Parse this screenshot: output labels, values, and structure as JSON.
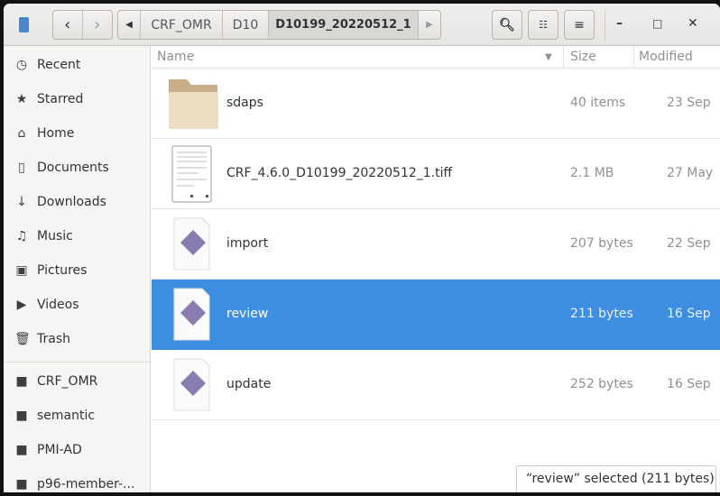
{
  "window": {
    "title": "D10199_20220512_1"
  },
  "toolbar": {
    "back": "back",
    "forward": "forward",
    "search": "search",
    "view_grid": "grid-view",
    "menu": "menu",
    "minimize": "minimize",
    "maximize": "maximize",
    "close": "close"
  },
  "breadcrumb": [
    "CRF_OMR",
    "D10",
    "D10199_20220512_1"
  ],
  "sidebar": {
    "places": [
      {
        "label": "Recent",
        "icon": "clock-icon"
      },
      {
        "label": "Starred",
        "icon": "star-icon"
      },
      {
        "label": "Home",
        "icon": "home-icon"
      },
      {
        "label": "Documents",
        "icon": "document-icon"
      },
      {
        "label": "Downloads",
        "icon": "download-icon"
      },
      {
        "label": "Music",
        "icon": "music-icon"
      },
      {
        "label": "Pictures",
        "icon": "camera-icon"
      },
      {
        "label": "Videos",
        "icon": "video-icon"
      },
      {
        "label": "Trash",
        "icon": "trash-icon"
      }
    ],
    "bookmarks": [
      {
        "label": "CRF_OMR"
      },
      {
        "label": "semantic"
      },
      {
        "label": "PMI-AD"
      },
      {
        "label": "p96-member-..."
      }
    ]
  },
  "columns": {
    "name": "Name",
    "size": "Size",
    "modified": "Modified"
  },
  "files": [
    {
      "name": "sdaps",
      "size": "40 items",
      "modified": "23 Sep",
      "type": "folder"
    },
    {
      "name": "CRF_4.6.0_D10199_20220512_1.tiff",
      "size": "2.1 MB",
      "modified": "27 May",
      "type": "image"
    },
    {
      "name": "import",
      "size": "207 bytes",
      "modified": "22 Sep",
      "type": "script"
    },
    {
      "name": "review",
      "size": "211 bytes",
      "modified": "16 Sep",
      "type": "script",
      "selected": true
    },
    {
      "name": "update",
      "size": "252 bytes",
      "modified": "16 Sep",
      "type": "script"
    }
  ],
  "status": "“review” selected  (211 bytes)",
  "colors": {
    "selection": "#3d8ee0",
    "folder": "#e9d6b8"
  }
}
